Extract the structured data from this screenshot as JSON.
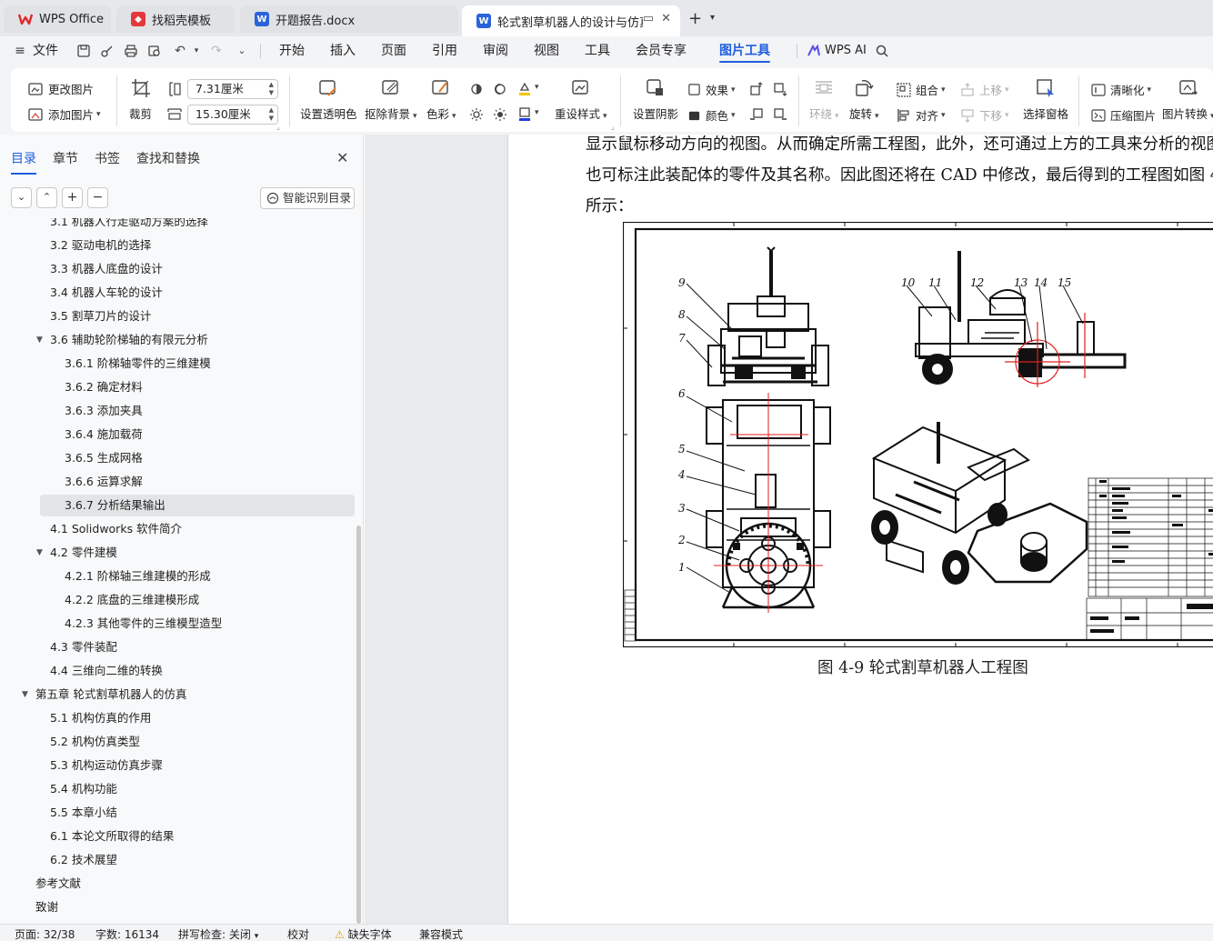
{
  "tabs": [
    {
      "label": "WPS Office",
      "icon": "wps-logo-icon"
    },
    {
      "label": "找稻壳模板",
      "icon": "docer-icon"
    },
    {
      "label": "开题报告.docx",
      "icon": "word-doc-icon"
    },
    {
      "label": "轮式割草机器人的设计与仿真",
      "icon": "word-doc-icon"
    }
  ],
  "menu": {
    "file": "文件",
    "items": [
      "开始",
      "插入",
      "页面",
      "引用",
      "审阅",
      "视图",
      "工具",
      "会员专享",
      "图片工具",
      "WPS AI"
    ],
    "active": "图片工具"
  },
  "ribbon": {
    "change_picture": "更改图片",
    "add_picture": "添加图片",
    "crop": "裁剪",
    "height_value": "7.31厘米",
    "width_value": "15.30厘米",
    "set_transparent": "设置透明色",
    "remove_background": "抠除背景",
    "color_mode": "色彩",
    "preset_style": "重设样式",
    "set_shadow": "设置阴影",
    "effects": "效果",
    "color": "颜色",
    "wrap": "环绕",
    "rotate": "旋转",
    "group": "组合",
    "align": "对齐",
    "move_up": "上移",
    "move_down": "下移",
    "selection_pane": "选择窗格",
    "sharpen": "清晰化",
    "compress": "压缩图片",
    "convert": "图片转换"
  },
  "nav_pane": {
    "tabs": [
      "目录",
      "章节",
      "书签",
      "查找和替换"
    ],
    "active_tab": "目录",
    "smart_toc": "智能识别目录",
    "toc": [
      {
        "label": "3.1 机器人行走驱动方案的选择",
        "level": 2
      },
      {
        "label": "3.2 驱动电机的选择",
        "level": 2
      },
      {
        "label": "3.3 机器人底盘的设计",
        "level": 2
      },
      {
        "label": "3.4  机器人车轮的设计",
        "level": 2
      },
      {
        "label": "3.5 割草刀片的设计",
        "level": 2
      },
      {
        "label": "3.6  辅助轮阶梯轴的有限元分析",
        "level": 2,
        "expanded": true
      },
      {
        "label": "3.6.1  阶梯轴零件的三维建模",
        "level": 3
      },
      {
        "label": "3.6.2  确定材料",
        "level": 3
      },
      {
        "label": "3.6.3  添加夹具",
        "level": 3
      },
      {
        "label": "3.6.4  施加载荷",
        "level": 3
      },
      {
        "label": "3.6.5  生成网格",
        "level": 3
      },
      {
        "label": "3.6.6  运算求解",
        "level": 3
      },
      {
        "label": "3.6.7  分析结果输出",
        "level": 3,
        "selected": true
      },
      {
        "label": "4.1 Solidworks 软件简介",
        "level": 2
      },
      {
        "label": "4.2  零件建模",
        "level": 2,
        "expanded": true
      },
      {
        "label": "4.2.1 阶梯轴三维建模的形成",
        "level": 3
      },
      {
        "label": "4.2.2  底盘的三维建模形成",
        "level": 3
      },
      {
        "label": "4.2.3 其他零件的三维模型造型",
        "level": 3
      },
      {
        "label": "4.3 零件装配",
        "level": 2
      },
      {
        "label": "4.4 三维向二维的转换",
        "level": 2
      },
      {
        "label": "第五章  轮式割草机器人的仿真",
        "level": 1,
        "expanded": true
      },
      {
        "label": "5.1 机构仿真的作用",
        "level": 2
      },
      {
        "label": "5.2 机构仿真类型",
        "level": 2
      },
      {
        "label": "5.3 机构运动仿真步骤",
        "level": 2
      },
      {
        "label": "5.4  机构功能",
        "level": 2
      },
      {
        "label": "5.5  本章小结",
        "level": 2
      },
      {
        "label": "6.1  本论文所取得的结果",
        "level": 2
      },
      {
        "label": "6.2  技术展望",
        "level": 2
      },
      {
        "label": "参考文献",
        "level": 1
      },
      {
        "label": "致谢",
        "level": 1
      }
    ]
  },
  "document": {
    "line1": "显示鼠标移动方向的视图。从而确定所需工程图，此外，还可通过上方的工具来分析的视图",
    "line2": "也可标注此装配体的零件及其名称。因此图还将在 CAD 中修改，最后得到的工程图如图 4",
    "line3": "所示：",
    "figure_labels": [
      "1",
      "2",
      "3",
      "4",
      "5",
      "6",
      "7",
      "8",
      "9",
      "10",
      "11",
      "12",
      "13",
      "14",
      "15"
    ],
    "caption": "图 4-9  轮式割草机器人工程图"
  },
  "status": {
    "page": "页面: 32/38",
    "words": "字数: 16134",
    "spellcheck": "拼写检查: 关闭",
    "proof": "校对",
    "missing_font": "缺失字体",
    "compat": "兼容模式"
  }
}
